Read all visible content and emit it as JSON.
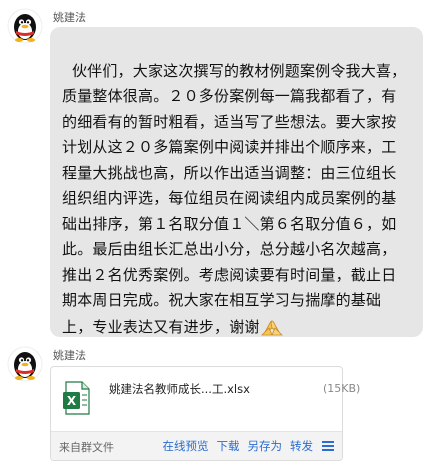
{
  "messages": [
    {
      "sender": "姚建法",
      "text": "伙伴们，大家这次撰写的教材例题案例令我大喜，质量整体很高。２０多份案例每一篇我都看了，有的细看有的暂时粗看，适当写了些想法。要大家按计划从这２０多篇案例中阅读并排出个顺序来，工程量大挑战也高，所以作出适当调整：由三位组长组织组内评选，每位组员在阅读组内成员案例的基础出排序，第１名取分值１＼第６名取分值６，如此。最后由组长汇总出小分，总分越小名次越高，推出２名优秀案例。考虑阅读要有时间量，截止日期本周日完成。祝大家在相互学习与揣摩的基础上，专业表达又有进步，谢谢",
      "emoji": "praying-hands-emoji"
    },
    {
      "sender": "姚建法",
      "file": {
        "name": "姚建法名教师成长...工.xlsx",
        "size": "(15KB)",
        "source": "来自群文件",
        "actions": [
          "在线预览",
          "下载",
          "另存为",
          "转发"
        ]
      }
    }
  ],
  "colors": {
    "bubble": "#e6e6e6",
    "link": "#2b6dd1",
    "excel": "#1f7a43"
  }
}
